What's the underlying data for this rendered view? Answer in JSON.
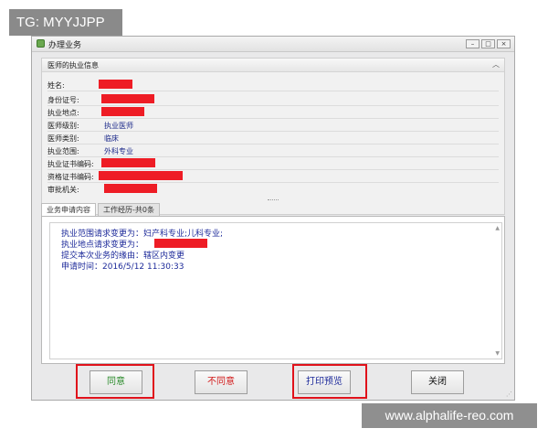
{
  "watermarks": {
    "tag": "TG: MYYJJPP",
    "site": "www.alphalife-reo.com"
  },
  "window": {
    "title": "办理业务",
    "controls": [
      "–",
      "□",
      "×"
    ]
  },
  "info_group": {
    "title": "医师的执业信息",
    "collapse_glyph": "︿",
    "rows": [
      {
        "label": "姓名:",
        "value": ""
      },
      {
        "label": "身份证号:",
        "value": ""
      },
      {
        "label": "执业地点:",
        "value": ""
      },
      {
        "label": "医师级别:",
        "value": "执业医师"
      },
      {
        "label": "医师类别:",
        "value": "临床"
      },
      {
        "label": "执业范围:",
        "value": "外科专业"
      },
      {
        "label": "执业证书编码:",
        "value": ""
      },
      {
        "label": "资格证书编码:",
        "value": ""
      },
      {
        "label": "审批机关:",
        "value": ""
      }
    ]
  },
  "tabs": [
    {
      "label": "业务申请内容",
      "active": true
    },
    {
      "label": "工作经历-共0条",
      "active": false
    }
  ],
  "content": {
    "lines": [
      "执业范围请求变更为：妇产科专业;儿科专业;",
      "执业地点请求变更为：",
      "提交本次业务的缘由：辖区内变更",
      "申请时间：2016/5/12 11:30:33"
    ]
  },
  "buttons": {
    "agree": "同意",
    "disagree": "不同意",
    "print_preview": "打印预览",
    "close": "关闭"
  },
  "colors": {
    "redaction": "#ee1c25",
    "highlight": "#e0121b",
    "text_blue": "#1d2a9a"
  }
}
